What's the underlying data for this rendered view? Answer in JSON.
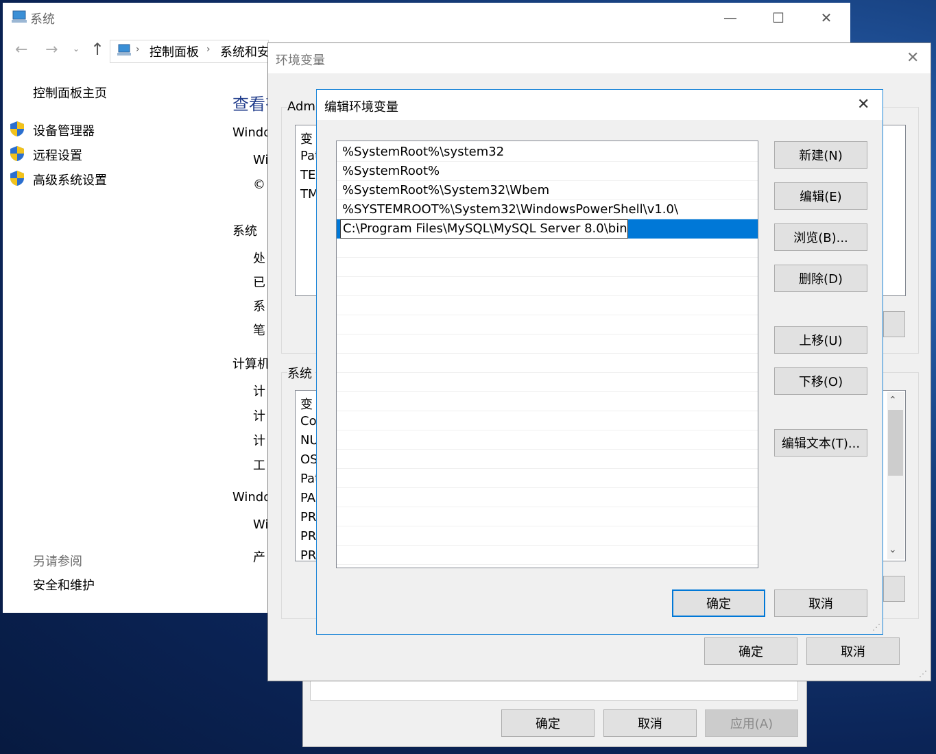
{
  "system_window": {
    "title": "系统",
    "breadcrumb": [
      "控制面板",
      "系统和安"
    ],
    "sidebar": {
      "home": "控制面板主页",
      "links": [
        "设备管理器",
        "远程设置",
        "高级系统设置"
      ],
      "see_also": "另请参阅",
      "see_also_links": [
        "安全和维护"
      ]
    },
    "content": {
      "heading": "查看有",
      "section1": "Windo",
      "line_wi1": "Wi",
      "line_copy": "©",
      "section_system": "系统",
      "sys_lines": [
        "处",
        "已",
        "系",
        "笔"
      ],
      "section_computer": "计算机",
      "comp_lines": [
        "计",
        "计",
        "计",
        "工"
      ],
      "section_windows": "Windo",
      "win_lines": [
        "Wi",
        "产"
      ]
    }
  },
  "system_props_dialog": {
    "ok": "确定",
    "cancel": "取消",
    "apply": "应用(A)"
  },
  "env_dialog": {
    "title": "环境变量",
    "user_group": "Adm",
    "user_vars_header": "变",
    "user_vars": [
      "Pat",
      "TE",
      "TM"
    ],
    "system_group": "系统",
    "system_vars_header": "变",
    "system_vars": [
      "Co",
      "NU",
      "OS",
      "Pat",
      "PA",
      "PR",
      "PR",
      "PR"
    ],
    "ok": "确定",
    "cancel": "取消"
  },
  "edit_dialog": {
    "title": "编辑环境变量",
    "paths": [
      "%SystemRoot%\\system32",
      "%SystemRoot%",
      "%SystemRoot%\\System32\\Wbem",
      "%SYSTEMROOT%\\System32\\WindowsPowerShell\\v1.0\\"
    ],
    "editing_value": "C:\\Program Files\\MySQL\\MySQL Server 8.0\\bin",
    "buttons": {
      "new": "新建(N)",
      "edit": "编辑(E)",
      "browse": "浏览(B)...",
      "delete": "删除(D)",
      "up": "上移(U)",
      "down": "下移(O)",
      "edit_text": "编辑文本(T)..."
    },
    "ok": "确定",
    "cancel": "取消"
  },
  "colors": {
    "accent": "#0078d7",
    "dialog_bg": "#f0f0f0",
    "button_bg": "#e1e1e1"
  }
}
